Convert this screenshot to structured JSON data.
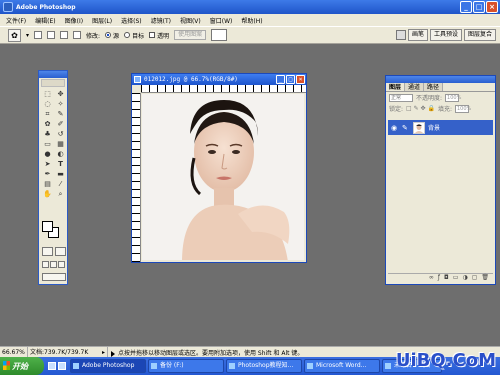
{
  "app": {
    "title": "Adobe Photoshop",
    "window_buttons": [
      "_",
      "□",
      "×"
    ]
  },
  "menu": [
    "文件(F)",
    "编辑(E)",
    "图像(I)",
    "图层(L)",
    "选择(S)",
    "滤镜(T)",
    "视图(V)",
    "窗口(W)",
    "帮助(H)"
  ],
  "options": {
    "modify_label": "修改:",
    "radio_1": "源",
    "radio_2": "目标",
    "check_transparent": "透明",
    "use_pattern": "使用图案",
    "right_tabs": [
      "画笔",
      "工具预设",
      "图层复合"
    ]
  },
  "document": {
    "title": "012012.jpg @ 66.7%(RGB/8#)",
    "ruler_marks": [
      "0",
      "2",
      "4",
      "6",
      "8",
      "10",
      "12",
      "14",
      "16",
      "18"
    ]
  },
  "layers": {
    "tabs": [
      "图层",
      "通道",
      "路径"
    ],
    "blend_mode": "正常",
    "opacity_label": "不透明度:",
    "opacity_value": "100%",
    "lock_label": "锁定:",
    "fill_label": "填充:",
    "fill_value": "100%",
    "layer_name": "背景"
  },
  "status": {
    "zoom": "66.67%",
    "doc": "文档:739.7K/739.7K",
    "message": "点按并拖移以移动图层或选区。要用附加选项，使用 Shift 和 Alt 键。"
  },
  "taskbar": {
    "start": "开始",
    "items": [
      "Adobe Photoshop",
      "备份 (F:)",
      "Photoshop教程知...",
      "Microsoft Word...",
      "未命名 - 画图"
    ]
  },
  "watermark": "UiBQ.CoM"
}
